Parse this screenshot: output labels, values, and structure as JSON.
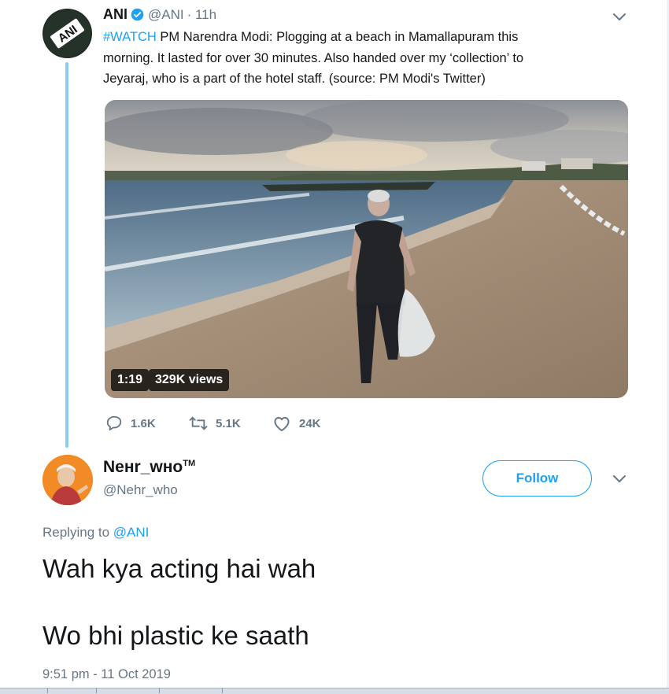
{
  "parent_tweet": {
    "name": "ANI",
    "handle": "@ANI",
    "time_ago": "· 11h",
    "hashtag": "#WATCH",
    "text_line1": " PM Narendra Modi: Plogging at a beach in Mamallapuram this",
    "text_line2": "morning. It lasted for over 30 minutes. Also handed over my ‘collection’ to",
    "text_line3": "Jeyaraj, who is a part of the hotel staff.  (source: PM Modi's Twitter)",
    "avatar_text": "ANI",
    "video": {
      "duration": "1:19",
      "views": "329K views"
    },
    "actions": {
      "replies": "1.6K",
      "retweets": "5.1K",
      "likes": "24K"
    }
  },
  "reply_tweet": {
    "name": "Nенr_wнo",
    "trademark": "TM",
    "handle": "@Nehr_who",
    "follow_label": "Follow",
    "replying_prefix": "Replying to ",
    "replying_to": "@ANI",
    "line1": "Wah kya acting hai wah",
    "line2": "Wo bhi plastic ke saath",
    "timestamp": "9:51 pm - 11 Oct 2019"
  },
  "colors": {
    "accent": "#1da1f2",
    "muted": "#657786",
    "thread_line": "#8ecbf1"
  },
  "icons": [
    "verified-badge-icon",
    "chevron-down-icon",
    "reply-icon",
    "retweet-icon",
    "like-icon"
  ]
}
